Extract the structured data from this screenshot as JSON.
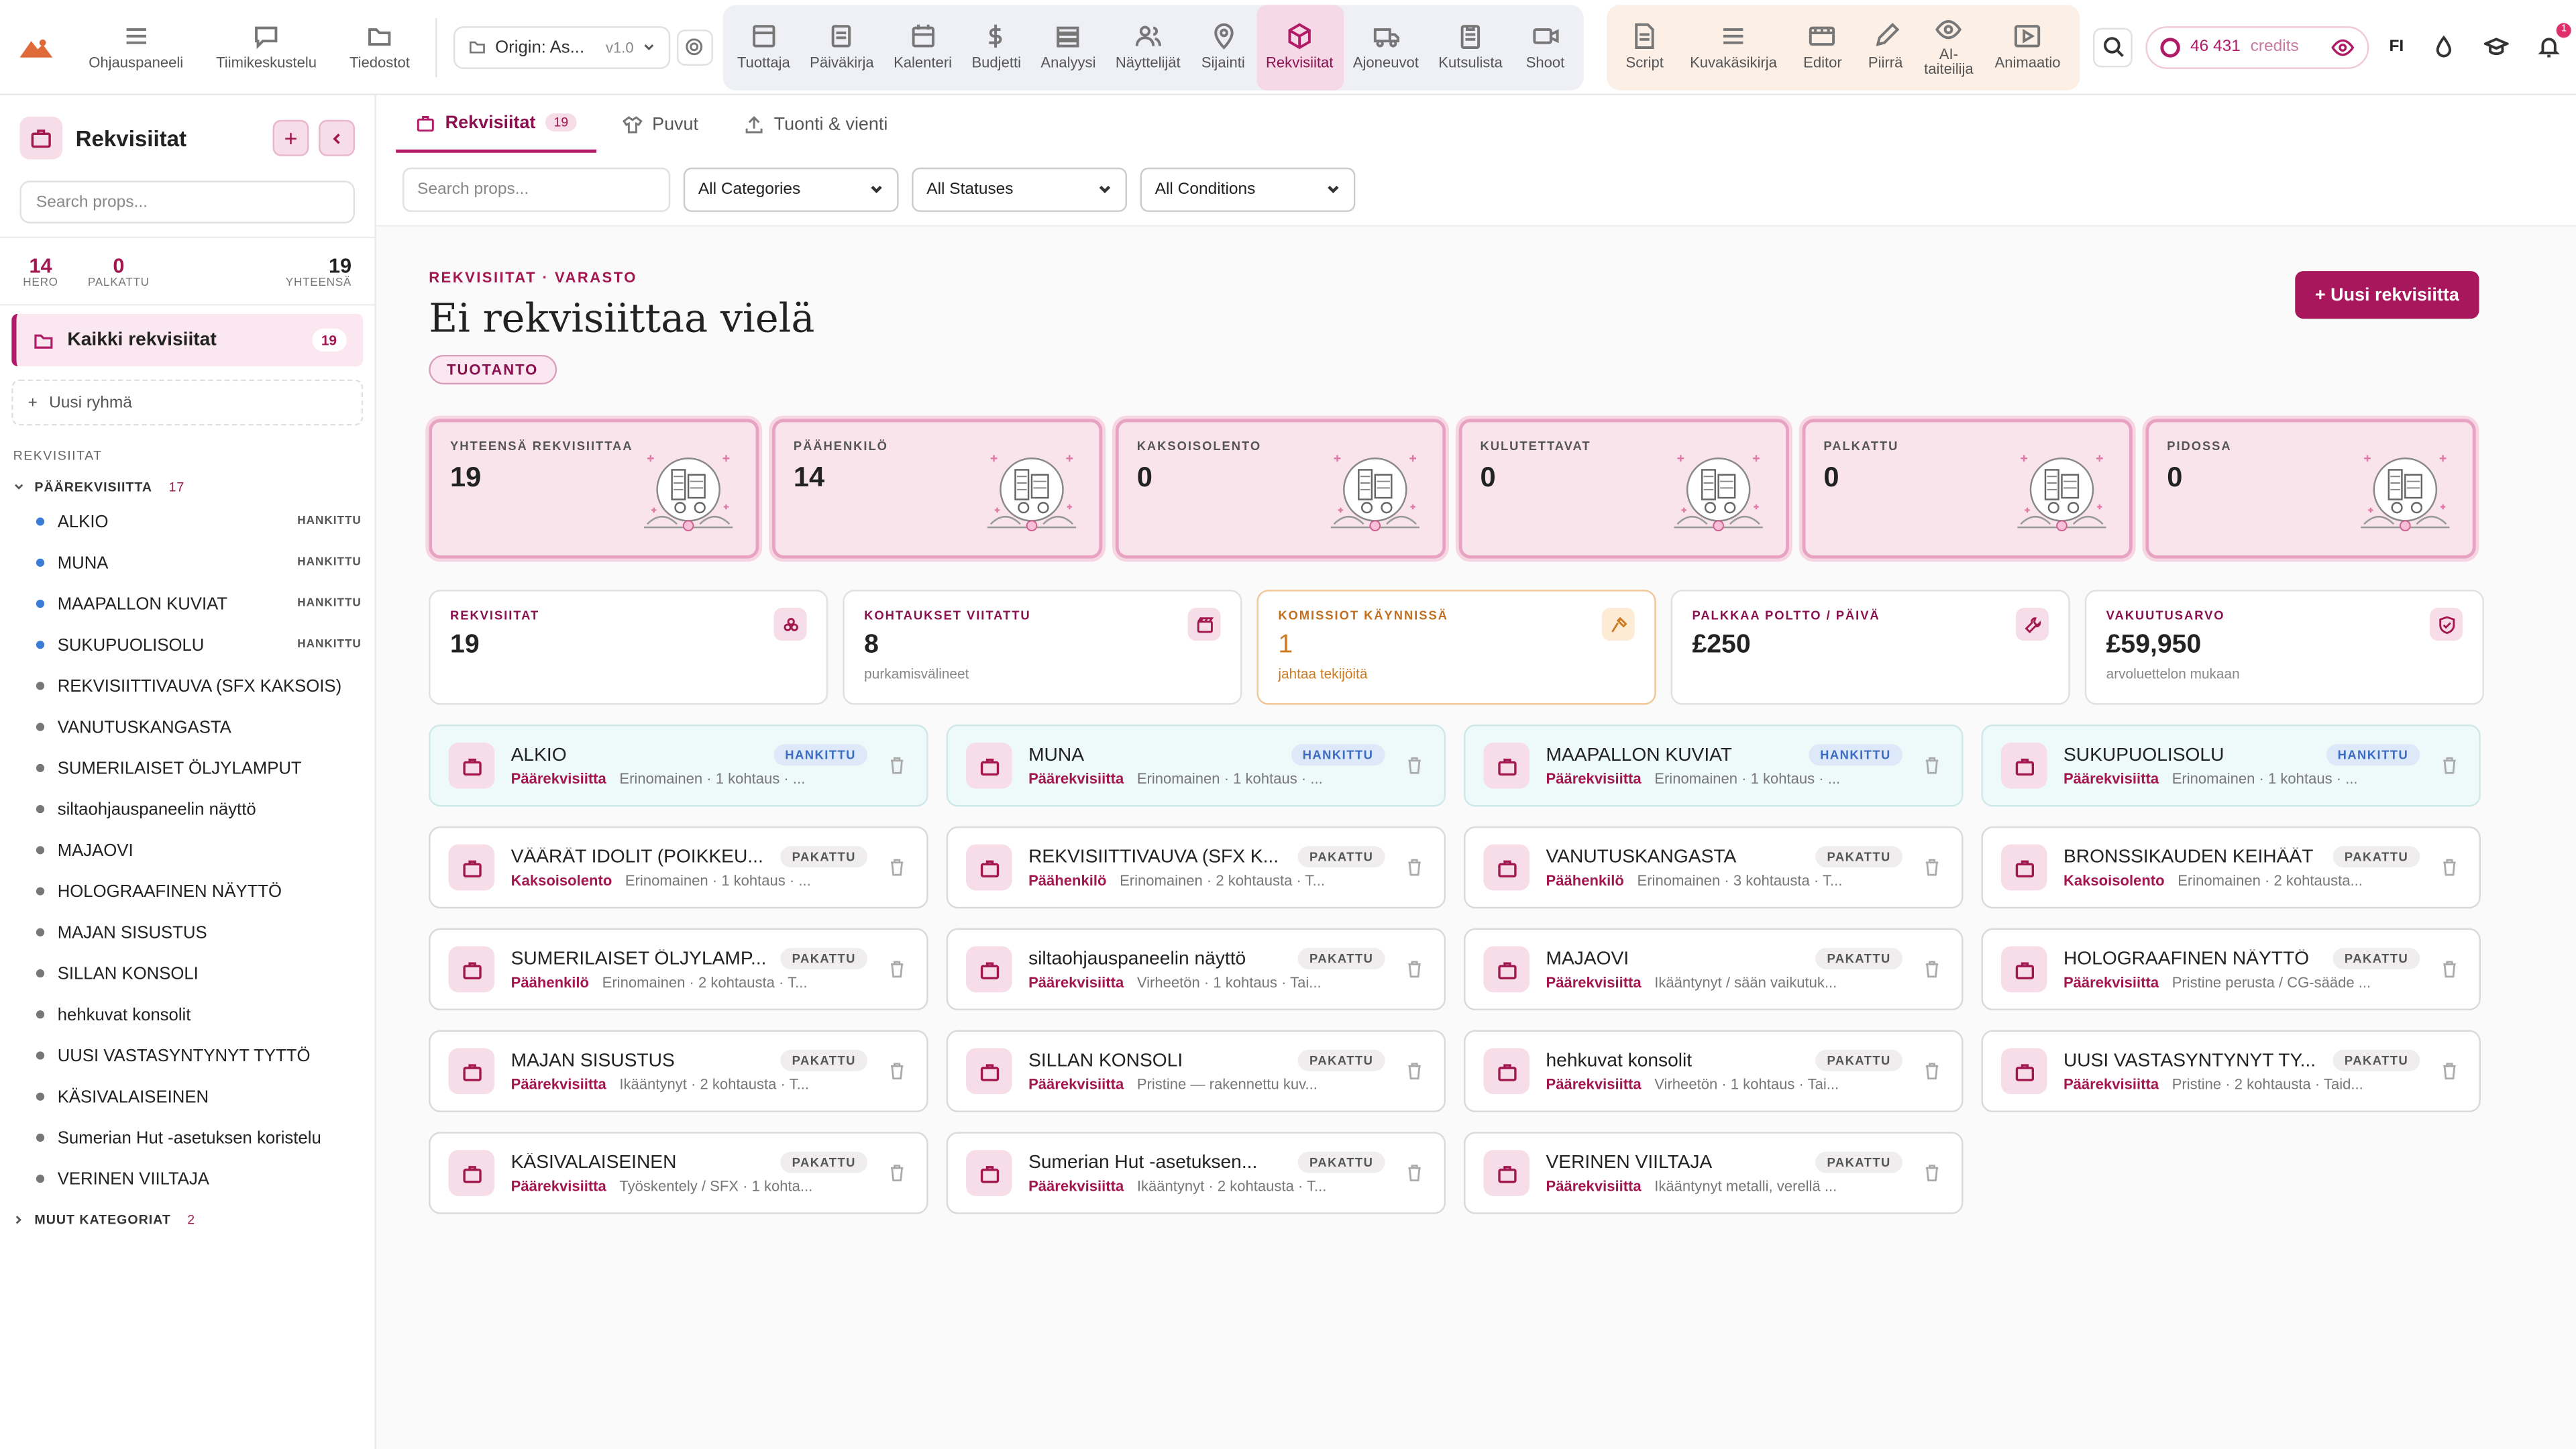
{
  "topbar": {
    "nav_left": [
      {
        "label": "Ohjauspaneeli",
        "icon": "menu-icon"
      },
      {
        "label": "Tiimikeskustelu",
        "icon": "chat-icon"
      },
      {
        "label": "Tiedostot",
        "icon": "folder-icon"
      }
    ],
    "project": {
      "name": "Origin: As...",
      "version": "v1.0"
    },
    "modules": [
      {
        "label": "Tuottaja",
        "icon": "layout-icon"
      },
      {
        "label": "Päiväkirja",
        "icon": "journal-icon"
      },
      {
        "label": "Kalenteri",
        "icon": "calendar-icon"
      },
      {
        "label": "Budjetti",
        "icon": "dollar-icon"
      },
      {
        "label": "Analyysi",
        "icon": "layers-icon"
      },
      {
        "label": "Näyttelijät",
        "icon": "users-icon"
      },
      {
        "label": "Sijainti",
        "icon": "map-pin-icon"
      },
      {
        "label": "Rekvisiitat",
        "icon": "cube-icon",
        "active": true
      },
      {
        "label": "Ajoneuvot",
        "icon": "truck-icon"
      },
      {
        "label": "Kutsulista",
        "icon": "clipboard-icon"
      },
      {
        "label": "Shoot",
        "icon": "video-icon"
      }
    ],
    "tools": [
      {
        "label": "Script",
        "icon": "document-icon"
      },
      {
        "label": "Kuvakäsikirja",
        "icon": "list-icon"
      },
      {
        "label": "Editor",
        "icon": "film-icon"
      },
      {
        "label": "Piirrä",
        "icon": "pen-icon"
      },
      {
        "label": "AI-taiteilija",
        "icon": "eye-icon"
      },
      {
        "label": "Animaatio",
        "icon": "play-icon"
      }
    ],
    "credits_value": "46 431",
    "credits_label": "credits",
    "language": "FI",
    "notification_count": "1"
  },
  "sidebar": {
    "title": "Rekvisiitat",
    "search_placeholder": "Search props...",
    "stats": [
      {
        "value": "14",
        "label": "HERO"
      },
      {
        "value": "0",
        "label": "PALKATTU"
      },
      {
        "value": "19",
        "label": "YHTEENSÄ"
      }
    ],
    "all_props_label": "Kaikki rekvisiitat",
    "all_props_count": "19",
    "new_group_label": "Uusi ryhmä",
    "section_label": "REKVISIITAT",
    "category_label": "PÄÄREKVISIITTA",
    "category_count": "17",
    "items": [
      {
        "name": "ALKIO",
        "status": "HANKITTU"
      },
      {
        "name": "MUNA",
        "status": "HANKITTU"
      },
      {
        "name": "MAAPALLON KUVIAT",
        "status": "HANKITTU"
      },
      {
        "name": "SUKUPUOLISOLU",
        "status": "HANKITTU"
      },
      {
        "name": "REKVISIITTIVAUVA (SFX KAKSOIS)",
        "status": ""
      },
      {
        "name": "VANUTUSKANGASTA",
        "status": ""
      },
      {
        "name": "SUMERILAISET ÖLJYLAMPUT",
        "status": ""
      },
      {
        "name": "siltaohjauspaneelin näyttö",
        "status": ""
      },
      {
        "name": "MAJAOVI",
        "status": ""
      },
      {
        "name": "HOLOGRAAFINEN NÄYTTÖ",
        "status": ""
      },
      {
        "name": "MAJAN SISUSTUS",
        "status": ""
      },
      {
        "name": "SILLAN KONSOLI",
        "status": ""
      },
      {
        "name": "hehkuvat konsolit",
        "status": ""
      },
      {
        "name": "UUSI VASTASYNTYNYT TYTTÖ",
        "status": ""
      },
      {
        "name": "KÄSIVALAISEINEN",
        "status": ""
      },
      {
        "name": "Sumerian Hut -asetuksen koristelu",
        "status": ""
      },
      {
        "name": "VERINEN VIILTAJA",
        "status": ""
      }
    ],
    "other_categories_label": "MUUT KATEGORIAT",
    "other_categories_count": "2"
  },
  "main": {
    "tabs": [
      {
        "label": "Rekvisiitat",
        "count": "19"
      },
      {
        "label": "Puvut"
      },
      {
        "label": "Tuonti & vienti"
      }
    ],
    "filters": {
      "search_placeholder": "Search props...",
      "category": "All Categories",
      "status": "All Statuses",
      "condition": "All Conditions"
    },
    "breadcrumb": "REKVISIITAT · VARASTO",
    "title": "Ei rekvisiittaa vielä",
    "phase_pill": "TUOTANTO",
    "new_button": "+ Uusi rekvisiitta",
    "placeholder_stats": [
      {
        "label": "YHTEENSÄ REKVISIITTAA",
        "value": "19"
      },
      {
        "label": "PÄÄHENKILÖ",
        "value": "14"
      },
      {
        "label": "KAKSOISOLENTO",
        "value": "0"
      },
      {
        "label": "KULUTETTAVAT",
        "value": "0"
      },
      {
        "label": "PALKATTU",
        "value": "0"
      },
      {
        "label": "PIDOSSA",
        "value": "0"
      }
    ],
    "metrics": [
      {
        "label": "REKVISIITAT",
        "value": "19",
        "sub": "",
        "icon": "box-stack-icon"
      },
      {
        "label": "KOHTAUKSET VIITATTU",
        "value": "8",
        "sub": "purkamisvälineet",
        "icon": "clapper-icon"
      },
      {
        "label": "KOMISSIOT KÄYNNISSÄ",
        "value": "1",
        "sub": "jahtaa tekijöitä",
        "icon": "hammer-icon",
        "warn": true
      },
      {
        "label": "PALKKAA POLTTO / PÄIVÄ",
        "value": "£250",
        "sub": "",
        "icon": "wrench-icon"
      },
      {
        "label": "VAKUUTUSARVO",
        "value": "£59,950",
        "sub": "arvoluettelon mukaan",
        "icon": "shield-icon"
      }
    ],
    "props": [
      {
        "name": "ALKIO",
        "status": "HANKITTU",
        "category": "Päärekvisiitta",
        "detail": "Erinomainen · 1 kohtaus · ..."
      },
      {
        "name": "MUNA",
        "status": "HANKITTU",
        "category": "Päärekvisiitta",
        "detail": "Erinomainen · 1 kohtaus · ..."
      },
      {
        "name": "MAAPALLON KUVIAT",
        "status": "HANKITTU",
        "category": "Päärekvisiitta",
        "detail": "Erinomainen · 1 kohtaus · ..."
      },
      {
        "name": "SUKUPUOLISOLU",
        "status": "HANKITTU",
        "category": "Päärekvisiitta",
        "detail": "Erinomainen · 1 kohtaus · ..."
      },
      {
        "name": "VÄÄRÄT IDOLIT (POIKKEU...",
        "status": "PAKATTU",
        "category": "Kaksoisolento",
        "detail": "Erinomainen · 1 kohtaus · ..."
      },
      {
        "name": "REKVISIITTIVAUVA (SFX K...",
        "status": "PAKATTU",
        "category": "Päähenkilö",
        "detail": "Erinomainen · 2 kohtausta · T..."
      },
      {
        "name": "VANUTUSKANGASTA",
        "status": "PAKATTU",
        "category": "Päähenkilö",
        "detail": "Erinomainen · 3 kohtausta · T..."
      },
      {
        "name": "BRONSSIKAUDEN KEIHÄÄT",
        "status": "PAKATTU",
        "category": "Kaksoisolento",
        "detail": "Erinomainen · 2 kohtausta..."
      },
      {
        "name": "SUMERILAISET ÖLJYLAMP...",
        "status": "PAKATTU",
        "category": "Päähenkilö",
        "detail": "Erinomainen · 2 kohtausta · T..."
      },
      {
        "name": "siltaohjauspaneelin näyttö",
        "status": "PAKATTU",
        "category": "Päärekvisiitta",
        "detail": "Virheetön · 1 kohtaus · Tai..."
      },
      {
        "name": "MAJAOVI",
        "status": "PAKATTU",
        "category": "Päärekvisiitta",
        "detail": "Ikääntynyt / sään vaikutuk..."
      },
      {
        "name": "HOLOGRAAFINEN NÄYTTÖ",
        "status": "PAKATTU",
        "category": "Päärekvisiitta",
        "detail": "Pristine perusta / CG-sääde ..."
      },
      {
        "name": "MAJAN SISUSTUS",
        "status": "PAKATTU",
        "category": "Päärekvisiitta",
        "detail": "Ikääntynyt · 2 kohtausta · T..."
      },
      {
        "name": "SILLAN KONSOLI",
        "status": "PAKATTU",
        "category": "Päärekvisiitta",
        "detail": "Pristine — rakennettu kuv..."
      },
      {
        "name": "hehkuvat konsolit",
        "status": "PAKATTU",
        "category": "Päärekvisiitta",
        "detail": "Virheetön · 1 kohtaus · Tai..."
      },
      {
        "name": "UUSI VASTASYNTYNYT TY...",
        "status": "PAKATTU",
        "category": "Päärekvisiitta",
        "detail": "Pristine · 2 kohtausta · Taid..."
      },
      {
        "name": "KÄSIVALAISEINEN",
        "status": "PAKATTU",
        "category": "Päärekvisiitta",
        "detail": "Työskentely / SFX · 1 kohta..."
      },
      {
        "name": "Sumerian Hut -asetuksen...",
        "status": "PAKATTU",
        "category": "Päärekvisiitta",
        "detail": "Ikääntynyt · 2 kohtausta · T..."
      },
      {
        "name": "VERINEN VIILTAJA",
        "status": "PAKATTU",
        "category": "Päärekvisiitta",
        "detail": "Ikääntynyt metalli, verellä ..."
      }
    ]
  },
  "colors": {
    "accent": "#a8165c",
    "accent_light": "#f6dde8",
    "acquired_bg": "#eefaf9",
    "warn": "#d07a20"
  }
}
